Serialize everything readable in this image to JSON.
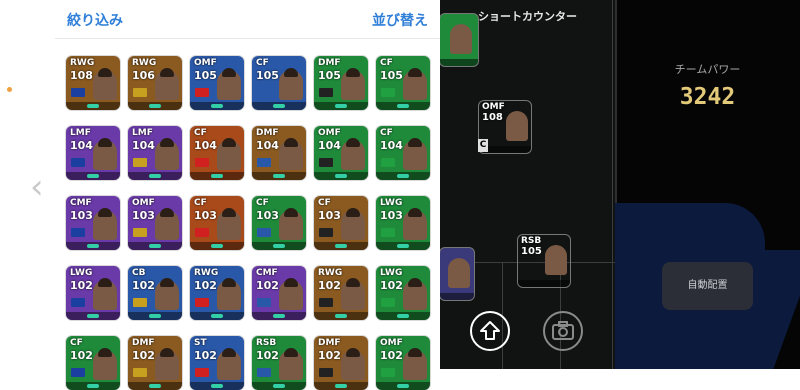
{
  "panel": {
    "filter_label": "絞り込み",
    "sort_label": "並び替え",
    "back_icon": "chevron-left-icon"
  },
  "players": [
    {
      "pos": "RWG",
      "rating": "108",
      "color": "#8a5a20"
    },
    {
      "pos": "RWG",
      "rating": "106",
      "color": "#8a5a20"
    },
    {
      "pos": "OMF",
      "rating": "105",
      "color": "#2a58a8"
    },
    {
      "pos": "CF",
      "rating": "105",
      "color": "#2a58a8"
    },
    {
      "pos": "DMF",
      "rating": "105",
      "color": "#1f8a3a"
    },
    {
      "pos": "CF",
      "rating": "105",
      "color": "#1f8a3a"
    },
    {
      "pos": "LMF",
      "rating": "104",
      "color": "#6a3aa8"
    },
    {
      "pos": "LMF",
      "rating": "104",
      "color": "#6a3aa8"
    },
    {
      "pos": "CF",
      "rating": "104",
      "color": "#a84a1a"
    },
    {
      "pos": "DMF",
      "rating": "104",
      "color": "#8a5a20"
    },
    {
      "pos": "OMF",
      "rating": "104",
      "color": "#1f8a3a"
    },
    {
      "pos": "CF",
      "rating": "104",
      "color": "#1f8a3a"
    },
    {
      "pos": "CMF",
      "rating": "103",
      "color": "#6a3aa8"
    },
    {
      "pos": "OMF",
      "rating": "103",
      "color": "#6a3aa8"
    },
    {
      "pos": "CF",
      "rating": "103",
      "color": "#a84a1a"
    },
    {
      "pos": "CF",
      "rating": "103",
      "color": "#1f8a3a"
    },
    {
      "pos": "CF",
      "rating": "103",
      "color": "#8a5a20"
    },
    {
      "pos": "LWG",
      "rating": "103",
      "color": "#1f8a3a"
    },
    {
      "pos": "LWG",
      "rating": "102",
      "color": "#6a3aa8"
    },
    {
      "pos": "CB",
      "rating": "102",
      "color": "#2a58a8"
    },
    {
      "pos": "RWG",
      "rating": "102",
      "color": "#2a58a8"
    },
    {
      "pos": "CMF",
      "rating": "102",
      "color": "#6a3aa8"
    },
    {
      "pos": "RWG",
      "rating": "102",
      "color": "#8a5a20"
    },
    {
      "pos": "LWG",
      "rating": "102",
      "color": "#1f8a3a"
    },
    {
      "pos": "CF",
      "rating": "102",
      "color": "#1f8a3a"
    },
    {
      "pos": "DMF",
      "rating": "102",
      "color": "#8a5a20"
    },
    {
      "pos": "ST",
      "rating": "102",
      "color": "#2a58a8"
    },
    {
      "pos": "RSB",
      "rating": "102",
      "color": "#1f8a3a"
    },
    {
      "pos": "DMF",
      "rating": "102",
      "color": "#8a5a20"
    },
    {
      "pos": "OMF",
      "rating": "102",
      "color": "#1f8a3a"
    }
  ],
  "field": {
    "formation_name": "ショートカウンター",
    "cards": [
      {
        "pos": "OMF",
        "rating": "108",
        "color": "#c8a050"
      },
      {
        "pos": "RSB",
        "rating": "105",
        "color": "#5a4a3a"
      }
    ],
    "c_mark": "C",
    "upload_icon": "arrow-up-circle-icon",
    "camera_icon": "camera-icon"
  },
  "right": {
    "team_power_label": "チームパワー",
    "team_power_value": "3242",
    "auto_button_label": "自動配置"
  }
}
